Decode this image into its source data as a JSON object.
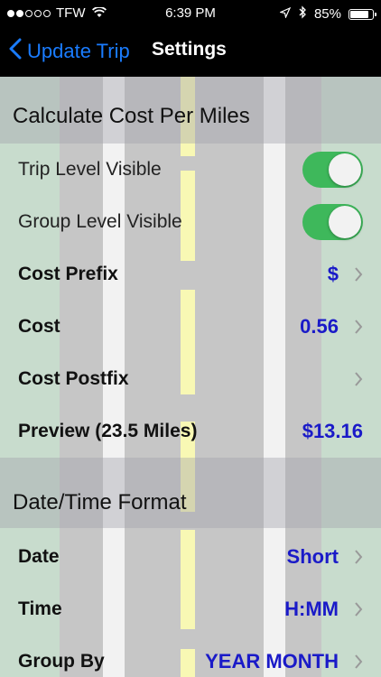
{
  "status_bar": {
    "carrier": "TFW",
    "time": "6:39 PM",
    "battery": "85%",
    "battery_level": 0.85
  },
  "nav": {
    "back_label": "Update Trip",
    "title": "Settings"
  },
  "sections": [
    {
      "title": "Calculate Cost Per Miles",
      "rows": [
        {
          "label": "Trip Level Visible",
          "type": "toggle",
          "on": true
        },
        {
          "label": "Group Level Visible",
          "type": "toggle",
          "on": true
        },
        {
          "label": "Cost Prefix",
          "value": "$",
          "type": "disclosure"
        },
        {
          "label": "Cost",
          "value": "0.56",
          "type": "disclosure"
        },
        {
          "label": "Cost Postfix",
          "value": "",
          "type": "disclosure"
        },
        {
          "label": "Preview (23.5 Miles)",
          "value": "$13.16",
          "type": "info"
        }
      ]
    },
    {
      "title": "Date/Time Format",
      "rows": [
        {
          "label": "Date",
          "value": "Short",
          "type": "disclosure"
        },
        {
          "label": "Time",
          "value": "H:MM",
          "type": "disclosure"
        },
        {
          "label": "Group By",
          "value": "YEAR MONTH",
          "type": "disclosure"
        }
      ]
    }
  ],
  "colors": {
    "accent_blue": "#1a7cff",
    "value_blue": "#1a1ac8",
    "toggle_green": "#3eb85b"
  }
}
